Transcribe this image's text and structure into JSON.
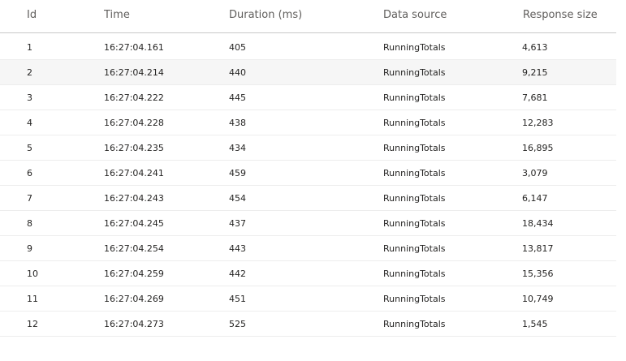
{
  "table": {
    "columns": {
      "id": "Id",
      "time": "Time",
      "duration": "Duration (ms)",
      "source": "Data source",
      "size": "Response size"
    },
    "rows": [
      {
        "id": "1",
        "time": "16:27:04.161",
        "duration": "405",
        "source": "RunningTotals",
        "size": "4,613"
      },
      {
        "id": "2",
        "time": "16:27:04.214",
        "duration": "440",
        "source": "RunningTotals",
        "size": "9,215"
      },
      {
        "id": "3",
        "time": "16:27:04.222",
        "duration": "445",
        "source": "RunningTotals",
        "size": "7,681"
      },
      {
        "id": "4",
        "time": "16:27:04.228",
        "duration": "438",
        "source": "RunningTotals",
        "size": "12,283"
      },
      {
        "id": "5",
        "time": "16:27:04.235",
        "duration": "434",
        "source": "RunningTotals",
        "size": "16,895"
      },
      {
        "id": "6",
        "time": "16:27:04.241",
        "duration": "459",
        "source": "RunningTotals",
        "size": "3,079"
      },
      {
        "id": "7",
        "time": "16:27:04.243",
        "duration": "454",
        "source": "RunningTotals",
        "size": "6,147"
      },
      {
        "id": "8",
        "time": "16:27:04.245",
        "duration": "437",
        "source": "RunningTotals",
        "size": "18,434"
      },
      {
        "id": "9",
        "time": "16:27:04.254",
        "duration": "443",
        "source": "RunningTotals",
        "size": "13,817"
      },
      {
        "id": "10",
        "time": "16:27:04.259",
        "duration": "442",
        "source": "RunningTotals",
        "size": "15,356"
      },
      {
        "id": "11",
        "time": "16:27:04.269",
        "duration": "451",
        "source": "RunningTotals",
        "size": "10,749"
      },
      {
        "id": "12",
        "time": "16:27:04.273",
        "duration": "525",
        "source": "RunningTotals",
        "size": "1,545"
      }
    ]
  }
}
